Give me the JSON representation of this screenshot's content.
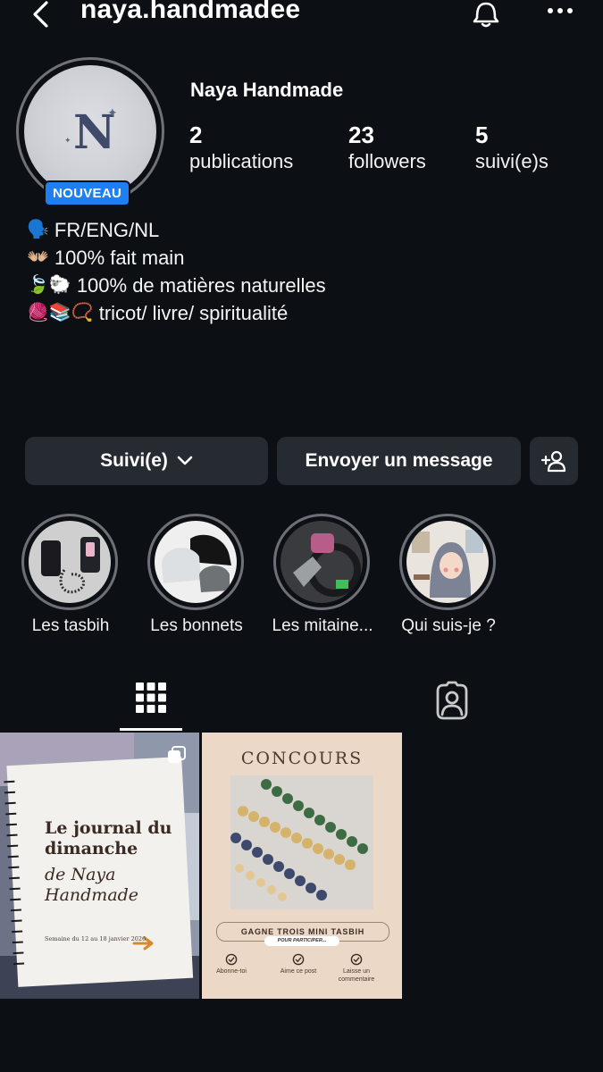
{
  "header": {
    "username": "naya.handmadee",
    "back_icon": "chevron-left-icon",
    "notifications_icon": "bell-icon",
    "more_icon": "more-horizontal-icon"
  },
  "profile": {
    "display_name": "Naya Handmade",
    "avatar_letter": "N",
    "badge": "NOUVEAU",
    "stats": {
      "posts_count": "2",
      "posts_label": "publications",
      "followers_count": "23",
      "followers_label": "followers",
      "following_count": "5",
      "following_label": "suivi(e)s"
    },
    "bio": [
      {
        "emoji": "🗣️",
        "text": "FR/ENG/NL"
      },
      {
        "emoji": "👐🏼",
        "text": "100% fait main"
      },
      {
        "emoji": "🍃🐑",
        "text": "100% de matières naturelles"
      },
      {
        "emoji": "🧶📚📿",
        "text": "tricot/ livre/ spiritualité"
      }
    ]
  },
  "actions": {
    "follow_label": "Suivi(e)",
    "message_label": "Envoyer un message",
    "add_user_icon": "add-user-icon"
  },
  "highlights": [
    {
      "label": "Les tasbih"
    },
    {
      "label": "Les bonnets"
    },
    {
      "label": "Les mitaine..."
    },
    {
      "label": "Qui suis-je ?"
    }
  ],
  "tabs": {
    "grid_icon": "grid-icon",
    "tagged_icon": "tagged-user-icon"
  },
  "posts": [
    {
      "title_line1": "Le journal du",
      "title_line2": "dimanche",
      "subtitle_line1": "de Naya",
      "subtitle_line2": "Handmade",
      "footer": "Semaine du 12 au 18 janvier 2026"
    },
    {
      "heading": "CONCOURS",
      "banner": "GAGNE TROIS MINI TASBIH",
      "sub_banner": "POUR PARTICIPER...",
      "steps": [
        "Abonne-toi",
        "Aime ce post",
        "Laisse un commentaire"
      ]
    }
  ],
  "colors": {
    "background": "#0c0f14",
    "button": "#262a31",
    "badge": "#1d7ff2"
  }
}
